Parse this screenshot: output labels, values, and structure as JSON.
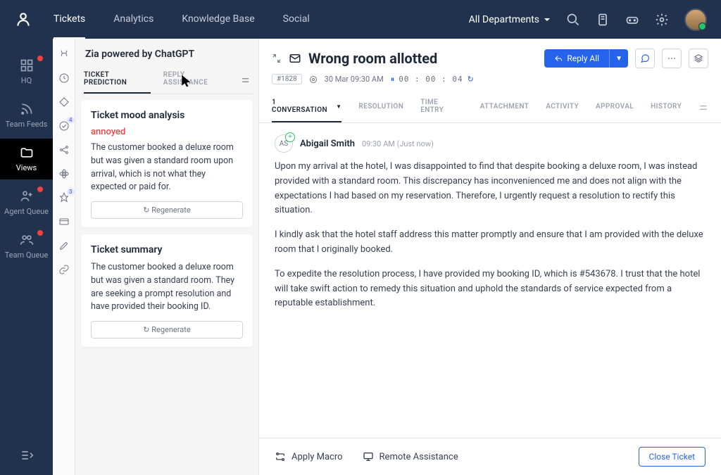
{
  "topnav": {
    "items": [
      "Tickets",
      "Analytics",
      "Knowledge Base",
      "Social"
    ],
    "active": 0,
    "department": "All Departments"
  },
  "leftbar": {
    "items": [
      {
        "label": "HQ",
        "dot": true
      },
      {
        "label": "Team Feeds",
        "dot": false
      },
      {
        "label": "Views",
        "dot": false,
        "active": true
      },
      {
        "label": "Agent Queue",
        "dot": true
      },
      {
        "label": "Team Queue",
        "dot": true
      }
    ]
  },
  "iconrail": {
    "badge_1": "4",
    "badge_2": "3"
  },
  "zia": {
    "title": "Zia powered by ChatGPT",
    "tabs": [
      "TICKET PREDICTION",
      "REPLY ASSISTANCE"
    ],
    "mood_card": {
      "title": "Ticket mood analysis",
      "mood": "annoyed",
      "text": "The customer booked a deluxe room but was given a standard room upon arrival, which is not what they expected or paid for.",
      "regen": "Regenerate"
    },
    "summary_card": {
      "title": "Ticket summary",
      "text": "The customer booked a deluxe room but was given a standard room. They are seeking a  prompt resolution and have provided their booking ID.",
      "regen": "Regenerate"
    }
  },
  "ticket": {
    "title": "Wrong room allotted",
    "reply_label": "Reply All",
    "id_label": "#1828",
    "date": "30 Mar 09:30 AM",
    "timer": "00 : 00 : 04",
    "tabs": [
      "1 CONVERSATION",
      "RESOLUTION",
      "TIME ENTRY",
      "ATTACHMENT",
      "ACTIVITY",
      "APPROVAL",
      "HISTORY"
    ],
    "message": {
      "avatar_initials": "AS",
      "author": "Abigail Smith",
      "time": "09:30 AM (Just now)",
      "p1": "Upon my arrival at the hotel, I was disappointed to find that despite booking a deluxe room, I was instead provided with a standard room. This discrepancy has inconvenienced me and does not align with the expectations I had based on my reservation. Therefore, I urgently request a resolution to rectify this situation.",
      "p2": "I kindly ask that the hotel staff address this matter promptly and ensure that I am provided with the deluxe room that I originally booked.",
      "p3": "To expedite the resolution process, I have provided my booking ID, which is #543678. I trust that the hotel will take swift action to remedy this situation and uphold the standards of service expected from a reputable establishment."
    },
    "footer": {
      "apply_macro": "Apply Macro",
      "remote": "Remote Assistance",
      "close": "Close Ticket"
    }
  }
}
